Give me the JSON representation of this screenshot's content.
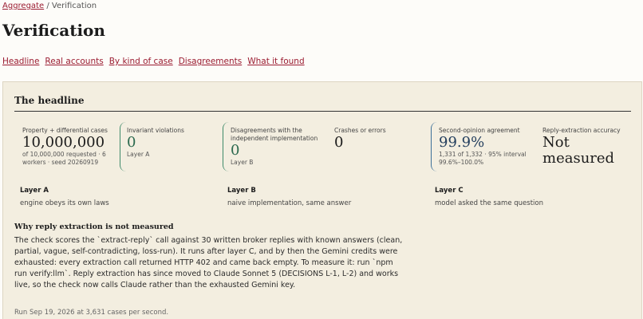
{
  "breadcrumb": {
    "link": "Aggregate",
    "separator": " / ",
    "current": "Verification"
  },
  "page_title": "Verification",
  "nav": [
    "Headline",
    "Real accounts",
    "By kind of case",
    "Disagreements",
    "What it found"
  ],
  "panel": {
    "title": "The headline",
    "stats": {
      "cases": {
        "label": "Property + differential cases",
        "value": "10,000,000",
        "note": "of 10,000,000 requested · 6 workers · seed 20260919"
      },
      "invariant": {
        "label": "Invariant violations",
        "value": "0",
        "note": "Layer A"
      },
      "disagreements": {
        "label": "Disagreements with the independent implementation",
        "value": "0",
        "note": "Layer B"
      },
      "crashes": {
        "label": "Crashes or errors",
        "value": "0"
      },
      "second_opinion": {
        "label": "Second-opinion agreement",
        "value": "99.9%",
        "note": "1,331 of 1,332 · 95% interval 99.6%–100.0%"
      },
      "reply_extraction": {
        "label": "Reply-extraction accuracy",
        "value": "Not measured"
      }
    },
    "layers": [
      {
        "name": "Layer A",
        "desc": "engine obeys its own laws"
      },
      {
        "name": "Layer B",
        "desc": "naive implementation, same answer"
      },
      {
        "name": "Layer C",
        "desc": "model asked the same question"
      }
    ],
    "why": {
      "title": "Why reply extraction is not measured",
      "text": "The check scores the `extract-reply` call against 30 written broker replies with known answers (clean, partial, vague, self-contradicting, loss-run). It runs after layer C, and by then the Gemini credits were exhausted: every extraction call returned HTTP 402 and came back empty. To measure it: run `npm run verify:llm`. Reply extraction has since moved to Claude Sonnet 5 (DECISIONS L-1, L-2) and works live, so the check now calls Claude rather than the exhausted Gemini key."
    },
    "run_note": "Run Sep 19, 2026 at 3,631 cases per second."
  }
}
